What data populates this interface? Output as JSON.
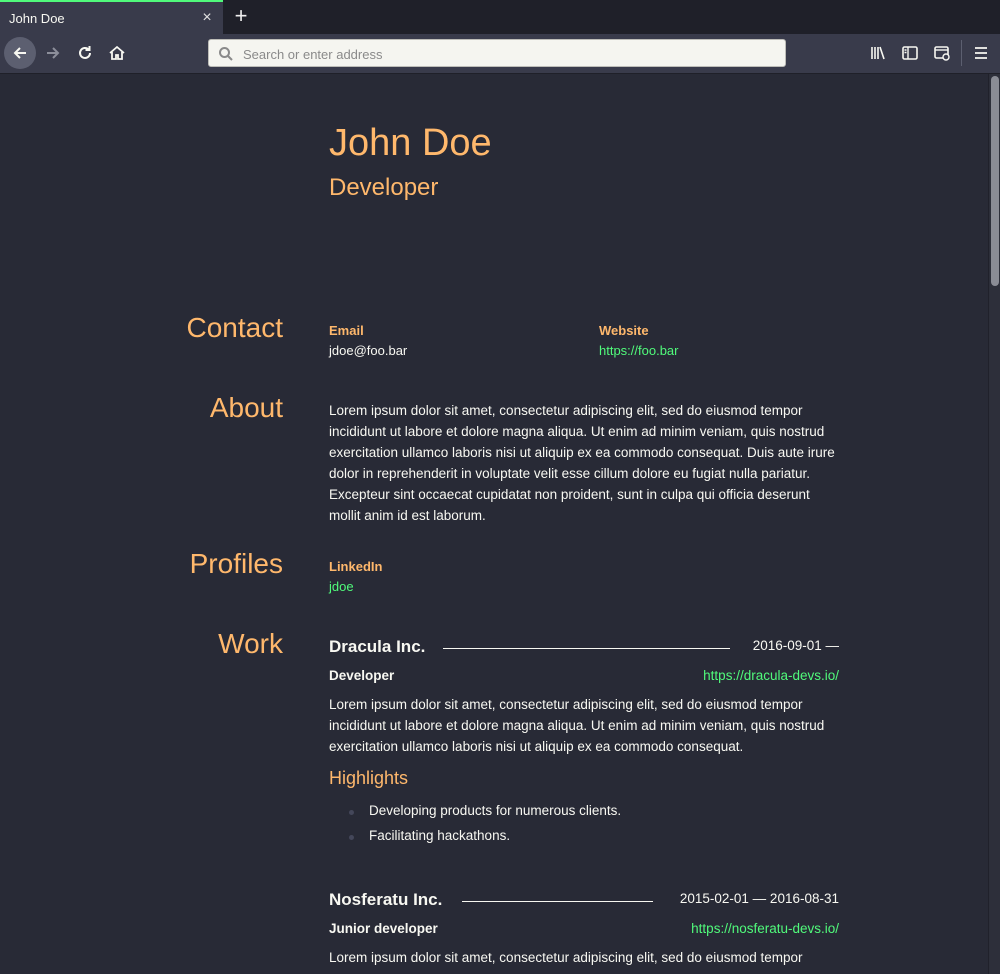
{
  "browser": {
    "tab_title": "John Doe",
    "tab_close": "×",
    "new_tab": "+",
    "address_placeholder": "Search or enter address"
  },
  "resume": {
    "name": "John Doe",
    "label": "Developer",
    "sections": {
      "contact": "Contact",
      "about": "About",
      "profiles": "Profiles",
      "work": "Work"
    },
    "contact": {
      "email_label": "Email",
      "email": "jdoe@foo.bar",
      "website_label": "Website",
      "website": "https://foo.bar"
    },
    "about": "Lorem ipsum dolor sit amet, consectetur adipiscing elit, sed do eiusmod tempor incididunt ut labore et dolore magna aliqua. Ut enim ad minim veniam, quis nostrud exercitation ullamco laboris nisi ut aliquip ex ea commodo consequat. Duis aute irure dolor in reprehenderit in voluptate velit esse cillum dolore eu fugiat nulla pariatur. Excepteur sint occaecat cupidatat non proident, sunt in culpa qui officia deserunt mollit anim id est laborum.",
    "profiles": [
      {
        "network": "LinkedIn",
        "username": "jdoe"
      }
    ],
    "work": [
      {
        "company": "Dracula Inc.",
        "dates": "2016-09-01 —",
        "position": "Developer",
        "website": "https://dracula-devs.io/",
        "summary": "Lorem ipsum dolor sit amet, consectetur adipiscing elit, sed do eiusmod tempor incididunt ut labore et dolore magna aliqua. Ut enim ad minim veniam, quis nostrud exercitation ullamco laboris nisi ut aliquip ex ea commodo consequat.",
        "highlights_title": "Highlights",
        "highlights": [
          "Developing products for numerous clients.",
          "Facilitating hackathons."
        ]
      },
      {
        "company": "Nosferatu Inc.",
        "dates": "2015-02-01 — 2016-08-31",
        "position": "Junior developer",
        "website": "https://nosferatu-devs.io/",
        "summary": "Lorem ipsum dolor sit amet, consectetur adipiscing elit, sed do eiusmod tempor"
      }
    ]
  },
  "colors": {
    "background": "#282a36",
    "accent": "#ffb86c",
    "link": "#50fa7b",
    "text": "#f8f8f2"
  }
}
